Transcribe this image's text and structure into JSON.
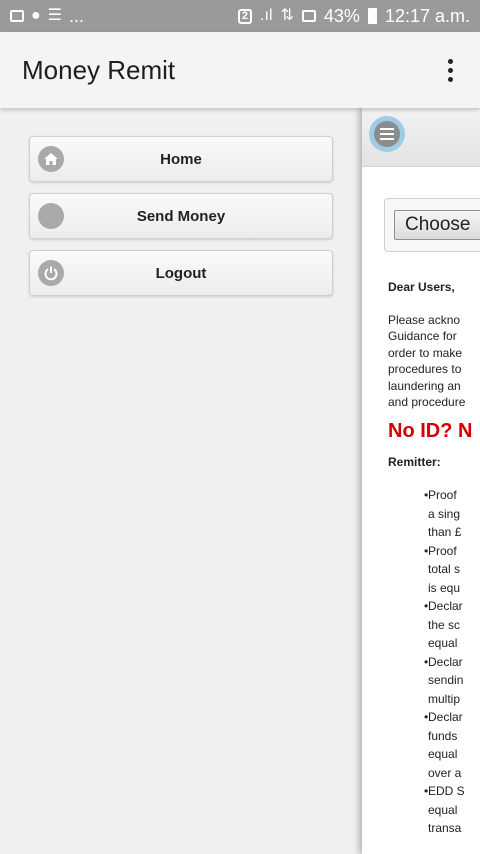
{
  "status_bar": {
    "left_more": "...",
    "sim": "2",
    "battery_percent": "43%",
    "time": "12:17 a.m."
  },
  "app_bar": {
    "title": "Money Remit",
    "overflow_icon": "more-vertical-icon"
  },
  "menu": {
    "items": [
      {
        "label": "Home",
        "icon": "home-icon"
      },
      {
        "label": "Send Money",
        "icon": "circle-icon"
      },
      {
        "label": "Logout",
        "icon": "power-icon"
      }
    ]
  },
  "panel": {
    "choose_label": "Choose",
    "greeting": "Dear Users,",
    "paragraph_lines": [
      "Please  ackno",
      "Guidance for",
      "order to make",
      "procedures to",
      "laundering an",
      "and procedure"
    ],
    "banner": "No ID? N",
    "remitter_label": "Remitter:",
    "bullets": [
      [
        "Proof",
        "a sing",
        "than £"
      ],
      [
        "Proof",
        "total s",
        "is equ"
      ],
      [
        "Declar",
        "the sc",
        "equal"
      ],
      [
        "Declar",
        "sendin",
        "multip"
      ],
      [
        "Declar",
        "funds",
        "equal",
        "over a"
      ],
      [
        "EDD S",
        "equal",
        "transa"
      ]
    ]
  }
}
